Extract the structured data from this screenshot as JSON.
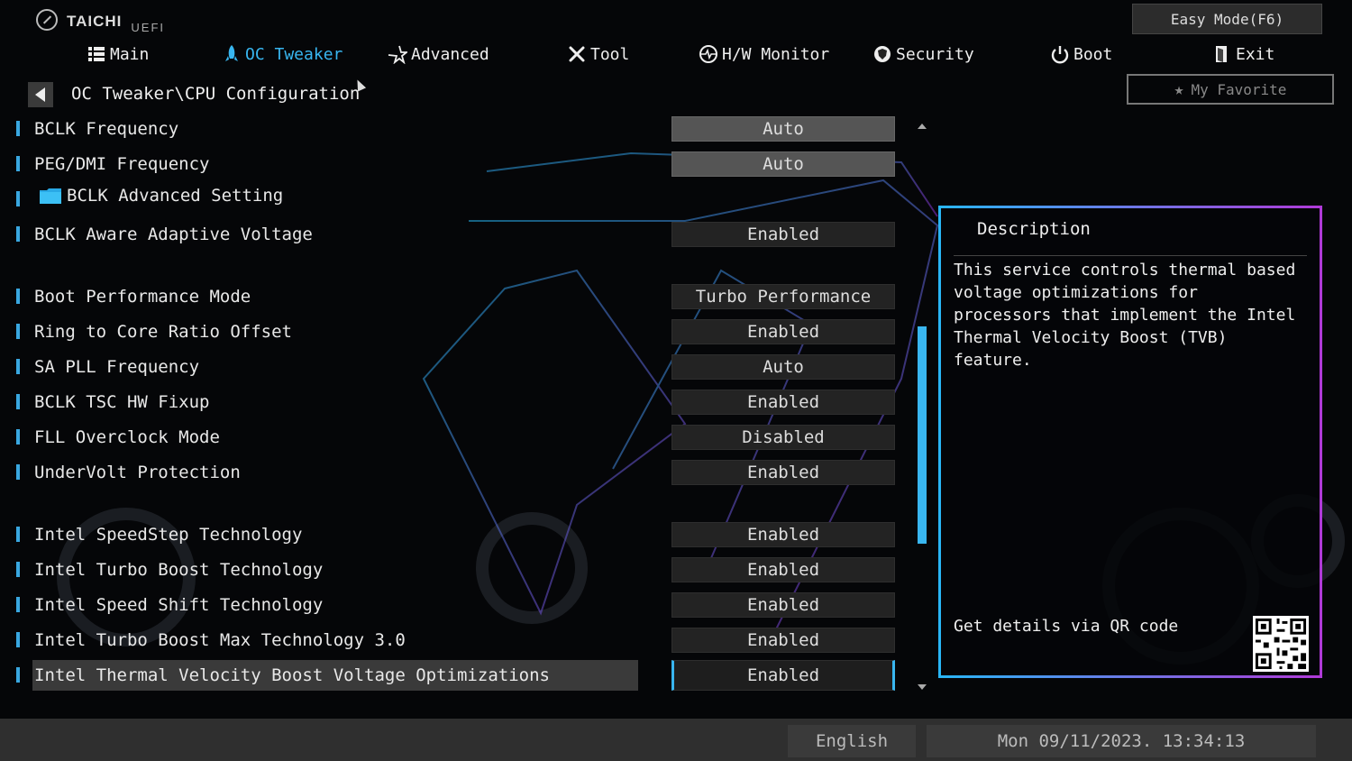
{
  "brand": {
    "name": "TAICHI",
    "sub": "UEFI"
  },
  "header": {
    "easy_mode": "Easy Mode(F6)",
    "my_favorite": "My Favorite",
    "tabs": [
      {
        "label": "Main",
        "icon": "list-icon",
        "active": false
      },
      {
        "label": "OC Tweaker",
        "icon": "rocket-icon",
        "active": true
      },
      {
        "label": "Advanced",
        "icon": "star-icon",
        "active": false
      },
      {
        "label": "Tool",
        "icon": "tools-icon",
        "active": false
      },
      {
        "label": "H/W Monitor",
        "icon": "monitor-icon",
        "active": false
      },
      {
        "label": "Security",
        "icon": "shield-icon",
        "active": false
      },
      {
        "label": "Boot",
        "icon": "power-icon",
        "active": false
      },
      {
        "label": "Exit",
        "icon": "exit-icon",
        "active": false
      }
    ]
  },
  "breadcrumb": "OC Tweaker\\CPU Configuration",
  "settings": [
    {
      "label": "BCLK Frequency",
      "value": "Auto"
    },
    {
      "label": "PEG/DMI Frequency",
      "value": "Auto"
    },
    {
      "label": "BCLK Advanced Setting",
      "value": ""
    },
    {
      "label": "BCLK Aware Adaptive Voltage",
      "value": "Enabled"
    },
    {
      "label": "Boot Performance Mode",
      "value": "Turbo Performance"
    },
    {
      "label": "Ring to Core Ratio Offset",
      "value": "Enabled"
    },
    {
      "label": "SA PLL Frequency",
      "value": "Auto"
    },
    {
      "label": "BCLK TSC HW Fixup",
      "value": "Enabled"
    },
    {
      "label": "FLL Overclock Mode",
      "value": "Disabled"
    },
    {
      "label": "UnderVolt Protection",
      "value": "Enabled"
    },
    {
      "label": "Intel SpeedStep Technology",
      "value": "Enabled"
    },
    {
      "label": "Intel Turbo Boost Technology",
      "value": "Enabled"
    },
    {
      "label": "Intel Speed Shift Technology",
      "value": "Enabled"
    },
    {
      "label": "Intel Turbo Boost Max Technology 3.0",
      "value": "Enabled"
    },
    {
      "label": "Intel Thermal Velocity Boost Voltage Optimizations",
      "value": "Enabled"
    }
  ],
  "description": {
    "title": "Description",
    "text": "This service controls thermal based voltage optimizations for processors that implement the Intel Thermal Velocity Boost (TVB) feature.",
    "qr_label": "Get details via QR code"
  },
  "footer": {
    "language": "English",
    "datetime": "Mon 09/11/2023. 13:34:13"
  },
  "colors": {
    "accent": "#39b6f0",
    "panel_border_start": "#29b6f6",
    "panel_border_end": "#b03ad8"
  }
}
